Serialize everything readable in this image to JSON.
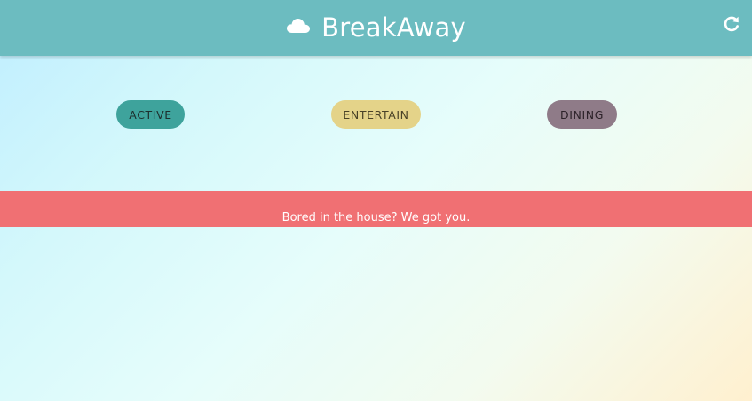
{
  "app": {
    "title": "BreakAway"
  },
  "header": {
    "logo_icon": "cloud-icon",
    "refresh_icon": "refresh-icon",
    "background_color": "#6cbcc0"
  },
  "categories": [
    {
      "label": "ACTIVE",
      "color": "#3ea39c"
    },
    {
      "label": "ENTERTAIN",
      "color": "#e4d389"
    },
    {
      "label": "DINING",
      "color": "#8f7b88"
    }
  ],
  "banner": {
    "text": "Bored in the house? We got you.",
    "color": "#f07073"
  }
}
